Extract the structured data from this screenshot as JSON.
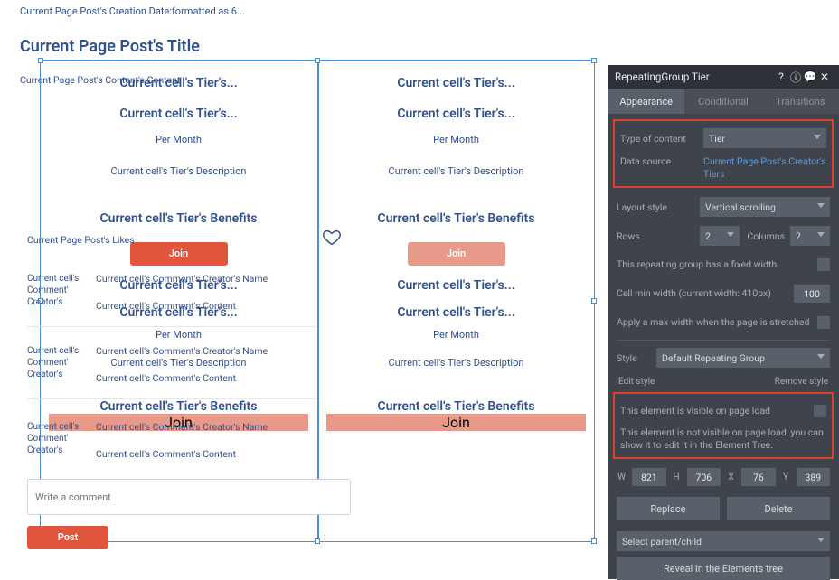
{
  "breadcrumb": "Current Page Post's Creation Date:formatted as 6...",
  "page_title": "Current Page Post's Title",
  "content_label": "Current Page Post's Content's Content",
  "tier_tile": {
    "line1": "Current cell's Tier's...",
    "line2": "Current cell's Tier's...",
    "per": "Per Month",
    "desc": "Current cell's Tier's Description",
    "benefits": "Current cell's Tier's Benefits",
    "join": "Join"
  },
  "overlay": {
    "like_label": "Current Page Post's Likes",
    "comment_creator_short": "Current cell's Comment' Creator's",
    "comment_creator_name": "Current cell's Comment's Creator's Name",
    "comment_content": "Current cell's Comment's Content",
    "input_placeholder": "Write a comment",
    "post": "Post"
  },
  "panel": {
    "title": "RepeatingGroup Tier",
    "tabs": {
      "appearance": "Appearance",
      "conditional": "Conditional",
      "transitions": "Transitions"
    },
    "type_of_content_label": "Type of content",
    "type_of_content_value": "Tier",
    "data_source_label": "Data source",
    "data_source_value": "Current Page Post's Creator's Tiers",
    "layout_style_label": "Layout style",
    "layout_style_value": "Vertical scrolling",
    "rows_label": "Rows",
    "rows_value": "2",
    "columns_label": "Columns",
    "columns_value": "2",
    "fixed_width": "This repeating group has a fixed width",
    "cell_min_width": "Cell min width (current width: 410px)",
    "cell_min_width_value": "100",
    "max_width": "Apply a max width when the page is stretched",
    "style_label": "Style",
    "style_value": "Default Repeating Group",
    "edit_style": "Edit style",
    "remove_style": "Remove style",
    "vis1": "This element is visible on page load",
    "vis2": "This element is not visible on page load, you can show it to edit it in the Element Tree.",
    "W": "821",
    "H": "706",
    "X": "76",
    "Y": "389",
    "replace": "Replace",
    "delete": "Delete",
    "select_parent": "Select parent/child",
    "reveal": "Reveal in the Elements tree"
  }
}
